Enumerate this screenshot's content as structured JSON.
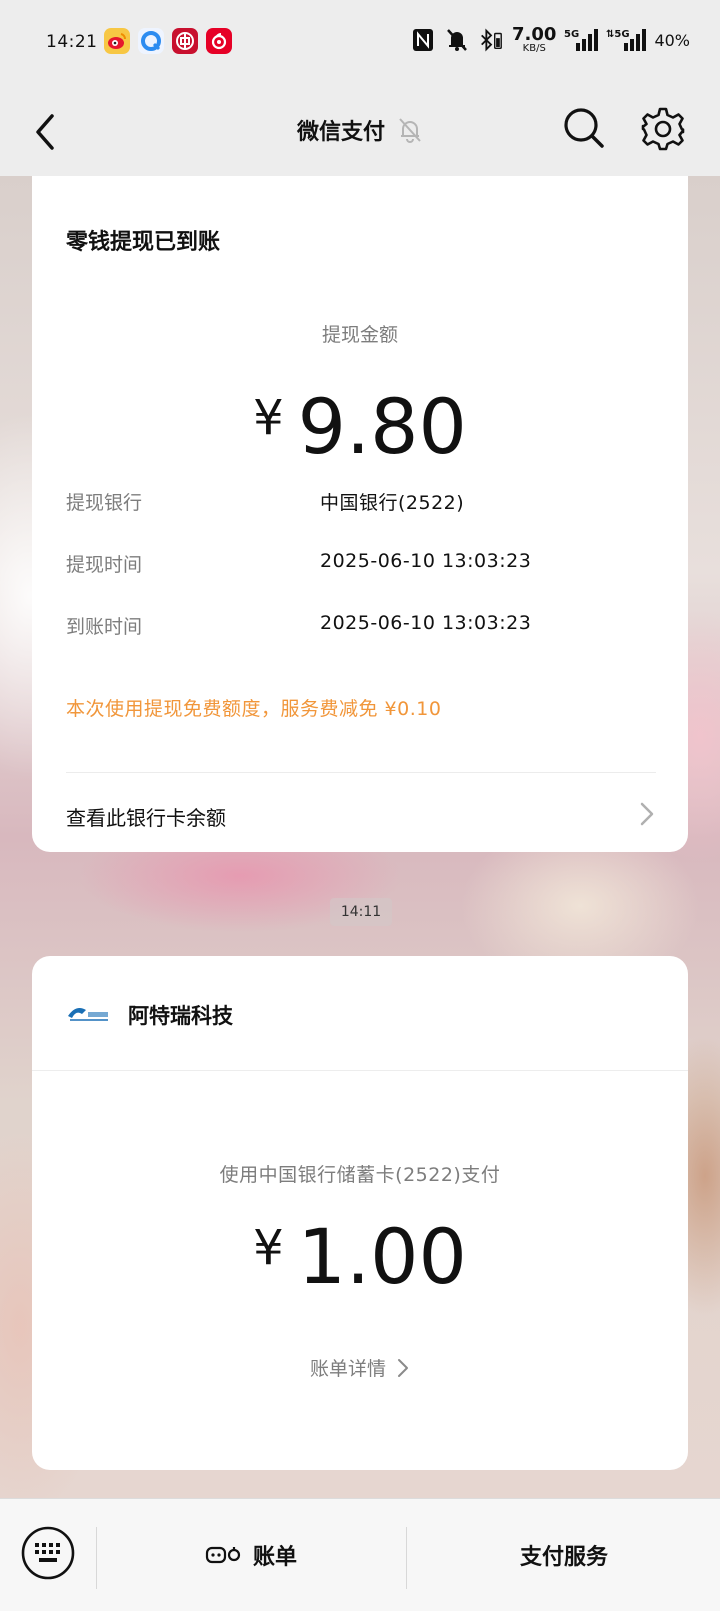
{
  "status_bar": {
    "time": "14:21",
    "apps": [
      "weibo-app-icon",
      "browser-app-icon",
      "bank-app-icon",
      "netease-music-app-icon"
    ],
    "net_speed": "7.00",
    "net_speed_unit": "KB/S",
    "signal1": "5G",
    "signal2": "5G",
    "battery": "40%"
  },
  "header": {
    "title": "微信支付"
  },
  "withdraw_card": {
    "title": "零钱提现已到账",
    "amount_label": "提现金额",
    "currency": "¥",
    "amount": "9.80",
    "rows": [
      {
        "key": "提现银行",
        "value": "中国银行(2522)"
      },
      {
        "key": "提现时间",
        "value": "2025-06-10 13:03:23"
      },
      {
        "key": "到账时间",
        "value": "2025-06-10 13:03:23"
      }
    ],
    "note": "本次使用提现免费额度，服务费减免 ¥0.10",
    "link": "查看此银行卡余额"
  },
  "chat_time": "14:11",
  "payment_card": {
    "merchant": "阿特瑞科技",
    "method": "使用中国银行储蓄卡(2522)支付",
    "currency": "¥",
    "amount": "1.00",
    "link": "账单详情"
  },
  "bottom_menu": {
    "item1": "账单",
    "item2": "支付服务"
  },
  "colors": {
    "note_orange": "#f1963a",
    "bg_gray": "#ededed"
  }
}
